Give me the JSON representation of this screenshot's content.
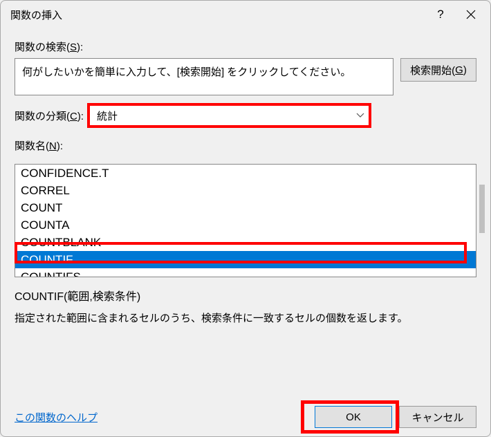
{
  "title": "関数の挿入",
  "search": {
    "label_prefix": "関数の検索(",
    "label_key": "S",
    "label_suffix": "):",
    "placeholder": "何がしたいかを簡単に入力して、[検索開始] をクリックしてください。",
    "button_prefix": "検索開始(",
    "button_key": "G",
    "button_suffix": ")"
  },
  "category": {
    "label_prefix": "関数の分類(",
    "label_key": "C",
    "label_suffix": "):",
    "value": "統計"
  },
  "function_name": {
    "label_prefix": "関数名(",
    "label_key": "N",
    "label_suffix": "):"
  },
  "functions": {
    "0": "CONFIDENCE.T",
    "1": "CORREL",
    "2": "COUNT",
    "3": "COUNTA",
    "4": "COUNTBLANK",
    "5": "COUNTIF",
    "6": "COUNTIFS"
  },
  "selected_index": 5,
  "syntax": "COUNTIF(範囲,検索条件)",
  "description": "指定された範囲に含まれるセルのうち、検索条件に一致するセルの個数を返します。",
  "help_link": "この関数のヘルプ",
  "ok_label": "OK",
  "cancel_label": "キャンセル"
}
